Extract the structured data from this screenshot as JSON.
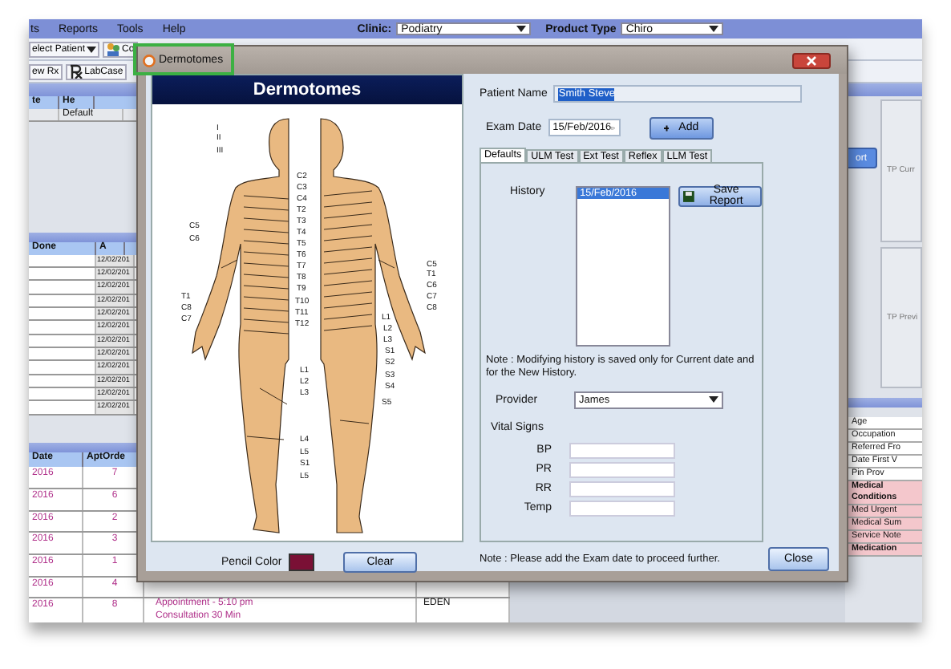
{
  "app": {
    "menu": [
      "ts",
      "Reports",
      "Tools",
      "Help"
    ],
    "clinic": {
      "label": "Clinic:",
      "value": "Podiatry"
    },
    "product_type": {
      "label": "Product Type",
      "value": "Chiro"
    },
    "toolbar_row_1": [
      "elect Patient",
      "Co"
    ],
    "toolbar_row_2": [
      "ew Rx",
      "LabCase"
    ],
    "top_grid": {
      "columns": [
        "te",
        "He"
      ],
      "rows": [
        {
          "column_2": "Default"
        }
      ]
    },
    "mid_grid": {
      "columns": [
        "Done",
        "A"
      ],
      "rows": [
        "12/02/201",
        "12/02/201",
        "12/02/201",
        "12/02/201",
        "12/02/201",
        "12/02/201",
        "12/02/201",
        "12/02/201",
        "12/02/201",
        "12/02/201",
        "12/02/201",
        "12/02/201"
      ]
    },
    "bottom_grid": {
      "columns": [
        "Date",
        "AptOrde"
      ],
      "rows": [
        {
          "date": "2016",
          "order": "7"
        },
        {
          "date": "2016",
          "order": "6"
        },
        {
          "date": "2016",
          "order": "2"
        },
        {
          "date": "2016",
          "order": "3"
        },
        {
          "date": "2016",
          "order": "1"
        },
        {
          "date": "2016",
          "order": "4"
        },
        {
          "date": "2016",
          "order": "8",
          "note": "Appointment - 5:10 pm",
          "note_2": "Consultation 30 Min",
          "column_4": "EDEN"
        }
      ]
    },
    "right": {
      "button": "ort",
      "panels": [
        "TP Curr",
        "TP Previ"
      ],
      "info_rows": [
        {
          "label": "Age",
          "kind": "field"
        },
        {
          "label": "Occupation",
          "kind": "field"
        },
        {
          "label": "Referred Fro",
          "kind": "field"
        },
        {
          "label": "Date First V",
          "kind": "field"
        },
        {
          "label": "Pin Prov",
          "kind": "field"
        },
        {
          "label": "Medical Conditions",
          "kind": "heading"
        },
        {
          "label": "Med Urgent",
          "kind": "alert"
        },
        {
          "label": "Medical Sum",
          "kind": "alert"
        },
        {
          "label": "Service Note",
          "kind": "alert"
        },
        {
          "label": "Medication",
          "kind": "heading"
        }
      ]
    }
  },
  "dialog": {
    "title": "Dermotomes",
    "figure": {
      "header": "Dermotomes",
      "labels": [
        "I",
        "II",
        "III",
        "C2",
        "C3",
        "C4",
        "T2",
        "T3",
        "T4",
        "T5",
        "T6",
        "T7",
        "T8",
        "T9",
        "T10",
        "T11",
        "T12",
        "C5",
        "C6",
        "T1",
        "C8",
        "C7",
        "L1",
        "L2",
        "L3",
        "L4",
        "L5",
        "S1",
        "L5",
        "C5",
        "T1",
        "C6",
        "C7",
        "C8",
        "L1",
        "L2",
        "L3",
        "S1",
        "S2",
        "S3",
        "S4",
        "S5"
      ]
    },
    "pencil_color": {
      "label": "Pencil Color",
      "color": "#7a1035"
    },
    "clear_button": "Clear",
    "patient_name": {
      "label": "Patient Name",
      "value": "Smith Steve",
      "highlighted": true
    },
    "exam_date": {
      "label": "Exam Date",
      "value": "15/Feb/2016"
    },
    "add_button": "Add",
    "tabs": [
      {
        "label": "Defaults",
        "selected": true
      },
      {
        "label": "ULM Test",
        "selected": false
      },
      {
        "label": "Ext Test",
        "selected": false
      },
      {
        "label": "Reflex",
        "selected": false
      },
      {
        "label": "LLM Test",
        "selected": false
      }
    ],
    "history": {
      "label": "History",
      "items": [
        {
          "text": "15/Feb/2016",
          "selected": true
        }
      ]
    },
    "save_report_button": "Save Report",
    "note": "Note : Modifying history is saved only for Current date and for the New History.",
    "provider": {
      "label": "Provider",
      "value": "James"
    },
    "vital_signs": {
      "label": "Vital Signs",
      "fields": [
        "BP",
        "PR",
        "RR",
        "Temp"
      ]
    },
    "footer_note": "Note : Please add the Exam date to proceed further.",
    "close_button": "Close"
  }
}
